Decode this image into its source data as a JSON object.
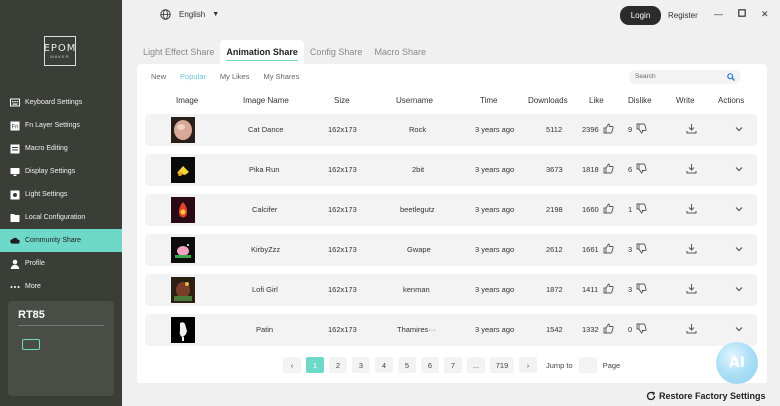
{
  "sidebar": {
    "logo_line1": "EPOM",
    "logo_line2": "MAKER",
    "items": [
      {
        "label": "Keyboard Settings",
        "icon": "keyboard-icon"
      },
      {
        "label": "Fn Layer Settings",
        "icon": "fn-icon"
      },
      {
        "label": "Macro Editing",
        "icon": "macro-icon"
      },
      {
        "label": "Display Settings",
        "icon": "display-icon"
      },
      {
        "label": "Light Settings",
        "icon": "light-icon"
      },
      {
        "label": "Local Configuration",
        "icon": "folder-icon"
      },
      {
        "label": "Community Share",
        "icon": "cloud-icon",
        "active": true
      },
      {
        "label": "Profile",
        "icon": "person-icon"
      },
      {
        "label": "More",
        "icon": "more-icon"
      }
    ],
    "device": {
      "name": "RT85"
    }
  },
  "topbar": {
    "language": "English",
    "login": "Login",
    "register": "Register"
  },
  "tabs": [
    "Light Effect Share",
    "Animation Share",
    "Config Share",
    "Macro Share"
  ],
  "active_tab": "Animation Share",
  "subtabs": [
    "New",
    "Popular",
    "My Likes",
    "My Shares"
  ],
  "active_subtab": "Popular",
  "search": {
    "placeholder": "Search"
  },
  "columns": [
    "Image",
    "Image Name",
    "Size",
    "Username",
    "Time",
    "Downloads",
    "Like",
    "Dislike",
    "Write",
    "Actions"
  ],
  "rows": [
    {
      "name": "Cat Dance",
      "size": "162x173",
      "user": "Rock",
      "time": "3 years ago",
      "downloads": "5112",
      "likes": "2396",
      "dislikes": "9"
    },
    {
      "name": "Pika Run",
      "size": "162x173",
      "user": "2bit",
      "time": "3 years ago",
      "downloads": "3673",
      "likes": "1818",
      "dislikes": "6"
    },
    {
      "name": "Calcifer",
      "size": "162x173",
      "user": "beetlegutz",
      "time": "3 years ago",
      "downloads": "2198",
      "likes": "1660",
      "dislikes": "1"
    },
    {
      "name": "KirbyZzz",
      "size": "162x173",
      "user": "Gwape",
      "time": "3 years ago",
      "downloads": "2612",
      "likes": "1661",
      "dislikes": "3"
    },
    {
      "name": "Lofi Girl",
      "size": "162x173",
      "user": "kenman",
      "time": "3 years ago",
      "downloads": "1872",
      "likes": "1411",
      "dislikes": "3"
    },
    {
      "name": "Patin",
      "size": "162x173",
      "user": "Thamires···",
      "time": "3 years ago",
      "downloads": "1542",
      "likes": "1332",
      "dislikes": "0"
    }
  ],
  "pagination": {
    "prev": "‹",
    "pages": [
      "1",
      "2",
      "3",
      "4",
      "5",
      "6",
      "7",
      "...",
      "719"
    ],
    "current": "1",
    "next": "›",
    "jump_label": "Jump to",
    "page_label": "Page"
  },
  "restore": "Restore Factory Settings",
  "ai_badge": "AI",
  "colors": {
    "accent": "#6fd9c9",
    "sidebar": "#3b3d37",
    "link_blue": "#6fc3d9"
  }
}
